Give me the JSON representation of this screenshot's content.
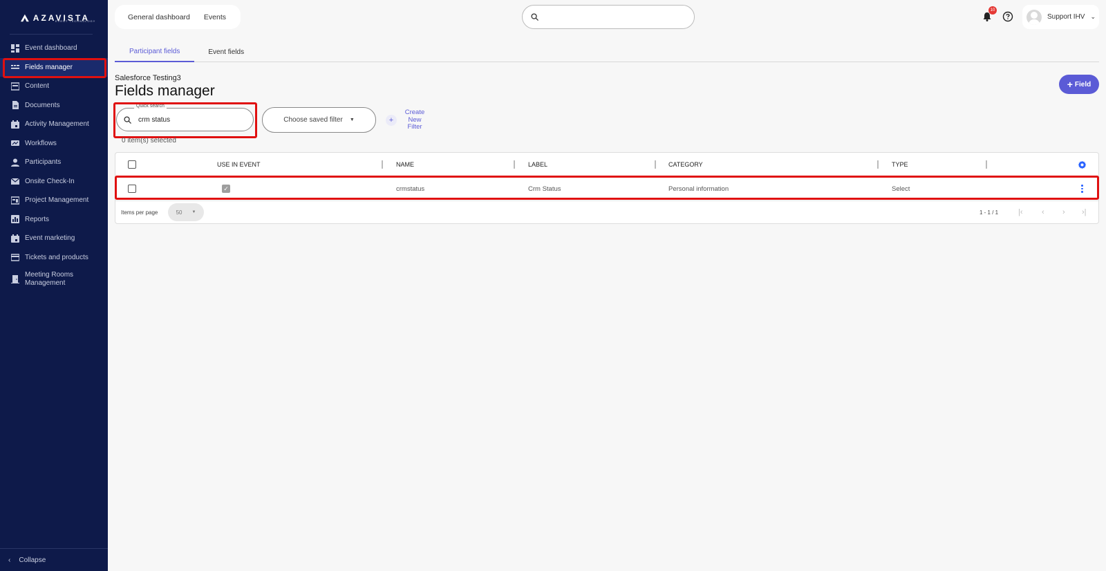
{
  "brand": {
    "name": "AZAVISTA",
    "tagline": "EVENT TECHNOLOGY"
  },
  "sidebar": {
    "items": [
      {
        "label": "Event dashboard",
        "icon": "dashboard-icon"
      },
      {
        "label": "Fields manager",
        "icon": "fields-icon",
        "active": true
      },
      {
        "label": "Content",
        "icon": "content-icon"
      },
      {
        "label": "Documents",
        "icon": "document-icon"
      },
      {
        "label": "Activity Management",
        "icon": "calendar-icon"
      },
      {
        "label": "Workflows",
        "icon": "workflow-icon"
      },
      {
        "label": "Participants",
        "icon": "person-icon"
      },
      {
        "label": "Onsite Check-In",
        "icon": "mail-icon"
      },
      {
        "label": "Project Management",
        "icon": "project-icon"
      },
      {
        "label": "Reports",
        "icon": "chart-icon"
      },
      {
        "label": "Event marketing",
        "icon": "calendar-icon"
      },
      {
        "label": "Tickets and products",
        "icon": "card-icon"
      },
      {
        "label": "Meeting Rooms Management",
        "icon": "door-icon"
      }
    ],
    "collapse_label": "Collapse"
  },
  "topnav": {
    "general_dashboard": "General dashboard",
    "events": "Events"
  },
  "notifications": {
    "count": "10"
  },
  "user": {
    "name": "Support IHV"
  },
  "tabs": [
    {
      "label": "Participant fields",
      "active": true
    },
    {
      "label": "Event fields",
      "active": false
    }
  ],
  "page": {
    "subtitle": "Salesforce Testing3",
    "title": "Fields manager",
    "add_field_label": "Field"
  },
  "filters": {
    "quick_search_label": "Quick search",
    "quick_search_value": "crm status",
    "saved_filter_placeholder": "Choose saved filter",
    "create_filter_label": "Create New Filter",
    "selected_count": "0 item(s) selected"
  },
  "table": {
    "columns": [
      "USE IN EVENT",
      "NAME",
      "LABEL",
      "CATEGORY",
      "TYPE"
    ],
    "rows": [
      {
        "use_in_event": true,
        "name": "crmstatus",
        "label": "Crm Status",
        "category": "Personal information",
        "type": "Select"
      }
    ],
    "items_per_page_label": "Items per page",
    "items_per_page_value": "50",
    "range": "1 - 1 / 1"
  },
  "colors": {
    "sidebar_bg": "#0e1a4a",
    "accent": "#5b5bd6",
    "highlight": "#e01010"
  }
}
